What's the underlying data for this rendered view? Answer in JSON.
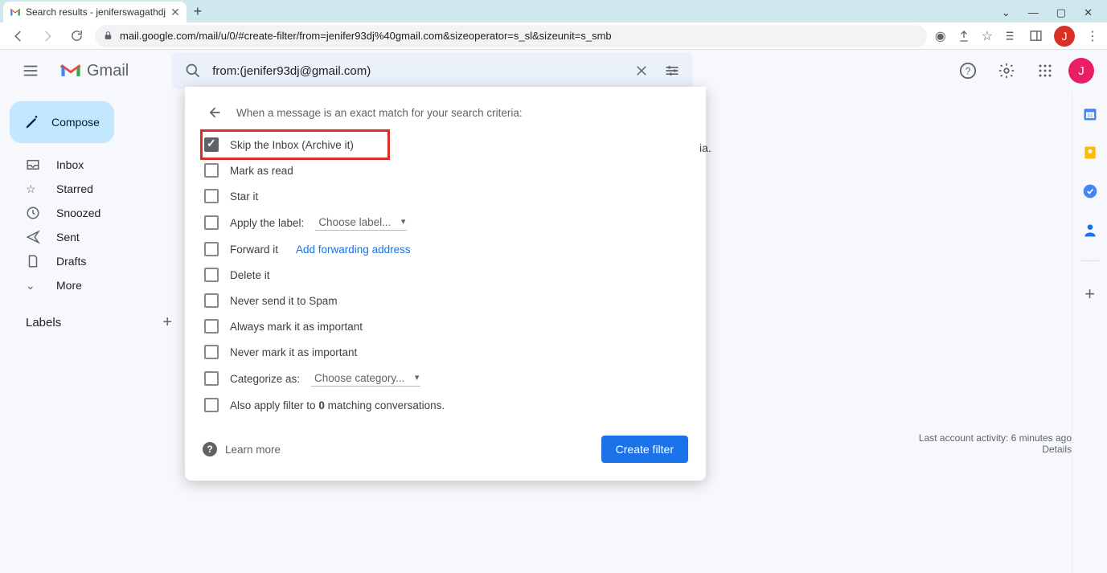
{
  "browser": {
    "tab_title": "Search results - jeniferswagathdj",
    "url": "mail.google.com/mail/u/0/#create-filter/from=jenifer93dj%40gmail.com&sizeoperator=s_sl&sizeunit=s_smb",
    "avatar_letter": "J"
  },
  "gmail": {
    "product_name": "Gmail",
    "search_value": "from:(jenifer93dj@gmail.com)",
    "compose": "Compose",
    "nav": {
      "inbox": "Inbox",
      "starred": "Starred",
      "snoozed": "Snoozed",
      "sent": "Sent",
      "drafts": "Drafts",
      "more": "More"
    },
    "labels_header": "Labels",
    "avatar_letter": "J"
  },
  "filter": {
    "heading": "When a message is an exact match for your search criteria:",
    "options": {
      "skip_inbox": "Skip the Inbox (Archive it)",
      "mark_read": "Mark as read",
      "star_it": "Star it",
      "apply_label": "Apply the label:",
      "apply_label_select": "Choose label...",
      "forward_it": "Forward it",
      "forward_link": "Add forwarding address",
      "delete_it": "Delete it",
      "never_spam": "Never send it to Spam",
      "always_important": "Always mark it as important",
      "never_important": "Never mark it as important",
      "categorize": "Categorize as:",
      "categorize_select": "Choose category...",
      "also_apply_pre": "Also apply filter to ",
      "also_apply_count": "0",
      "also_apply_post": " matching conversations."
    },
    "learn_more": "Learn more",
    "create_button": "Create filter"
  },
  "body_fragment": "ia.",
  "activity": {
    "line": "Last account activity: 6 minutes ago",
    "details": "Details"
  }
}
